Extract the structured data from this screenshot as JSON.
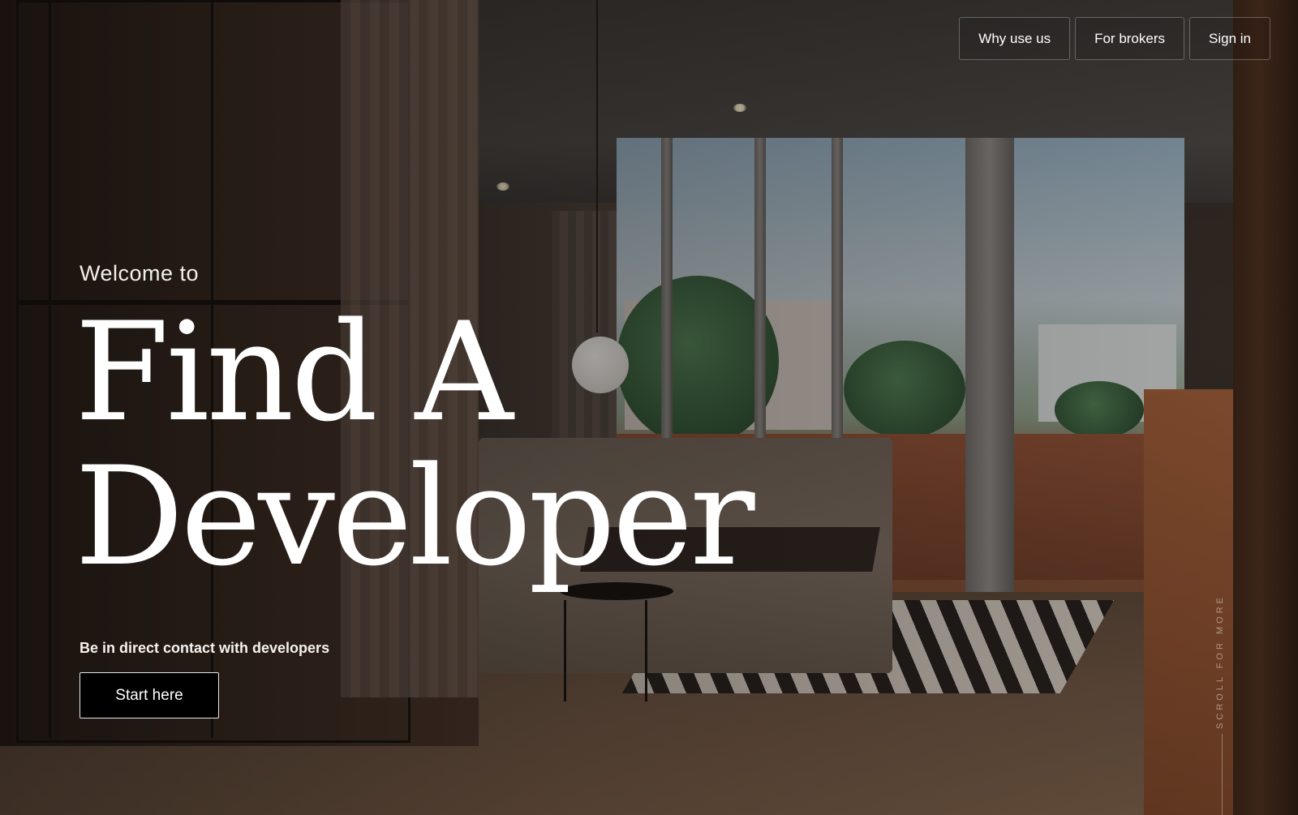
{
  "nav": {
    "items": [
      {
        "label": "Why use us"
      },
      {
        "label": "For brokers"
      },
      {
        "label": "Sign in"
      }
    ]
  },
  "hero": {
    "welcome": "Welcome to",
    "headline_line1": "Find A",
    "headline_line2": "Developer",
    "tagline": "Be in direct contact with developers",
    "cta_label": "Start here"
  },
  "scroll_hint": {
    "label": "SCROLL FOR MORE"
  }
}
